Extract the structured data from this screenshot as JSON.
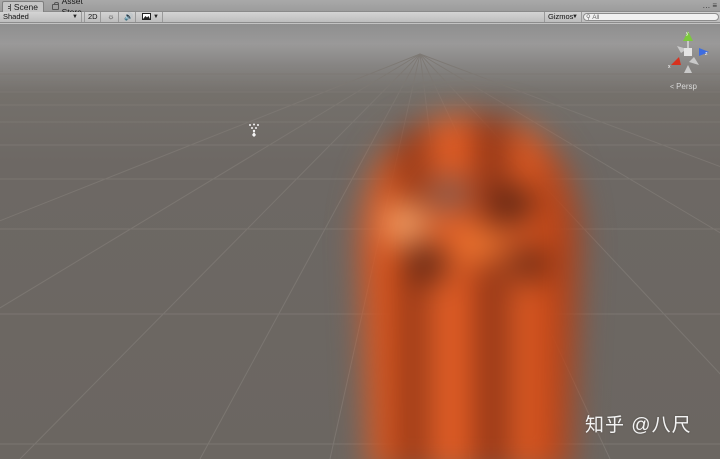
{
  "tabs": [
    {
      "label": "Scene",
      "icon": "grid-icon",
      "active": true
    },
    {
      "label": "Asset Store",
      "icon": "shopping-bag-icon",
      "active": false
    }
  ],
  "window_controls": {
    "more": "…",
    "menu": "≡"
  },
  "toolbar": {
    "shading_mode": "Shaded",
    "mode_2d": "2D",
    "lighting_toggle_icon": "sun-icon",
    "audio_toggle_icon": "speaker-icon",
    "effects_icon": "image-icon",
    "gizmos_label": "Gizmos",
    "search_placeholder": "All"
  },
  "scene": {
    "projection_label": "Persp",
    "gizmo_axes": [
      "x",
      "y",
      "z"
    ],
    "axis_colors": {
      "x": "#d8321f",
      "y": "#7cc93c",
      "z": "#3d6ce0"
    },
    "object_color": "#e05a1c"
  },
  "watermark": "知乎 @八尺"
}
